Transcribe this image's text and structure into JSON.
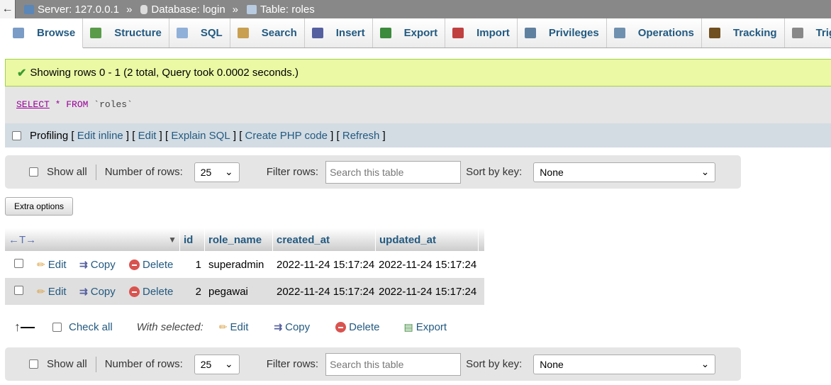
{
  "breadcrumb": {
    "back": "←",
    "server": "Server: 127.0.0.1",
    "database": "Database: login",
    "table": "Table: roles",
    "separator": "»"
  },
  "tabs": [
    {
      "label": "Browse",
      "icon": "browse-icon"
    },
    {
      "label": "Structure",
      "icon": "structure-icon"
    },
    {
      "label": "SQL",
      "icon": "sql-icon"
    },
    {
      "label": "Search",
      "icon": "search-icon"
    },
    {
      "label": "Insert",
      "icon": "insert-icon"
    },
    {
      "label": "Export",
      "icon": "export-icon"
    },
    {
      "label": "Import",
      "icon": "import-icon"
    },
    {
      "label": "Privileges",
      "icon": "privileges-icon"
    },
    {
      "label": "Operations",
      "icon": "operations-icon"
    },
    {
      "label": "Tracking",
      "icon": "tracking-icon"
    },
    {
      "label": "Trigge",
      "icon": "triggers-icon"
    }
  ],
  "success": "Showing rows 0 - 1 (2 total, Query took 0.0002 seconds.)",
  "sql": {
    "select": "SELECT",
    "star": "*",
    "from": "FROM",
    "table": "`roles`"
  },
  "profiling": {
    "label": "Profiling",
    "edit_inline": "Edit inline",
    "edit": "Edit",
    "explain": "Explain SQL",
    "php": "Create PHP code",
    "refresh": "Refresh"
  },
  "nav": {
    "show_all": "Show all",
    "rows_label": "Number of rows:",
    "rows_value": "25",
    "filter_label": "Filter rows:",
    "filter_placeholder": "Search this table",
    "sort_label": "Sort by key:",
    "sort_value": "None"
  },
  "extra_options": "Extra options",
  "table": {
    "columns": [
      "id",
      "role_name",
      "created_at",
      "updated_at"
    ],
    "rows": [
      {
        "id": "1",
        "role_name": "superadmin",
        "created_at": "2022-11-24 15:17:24",
        "updated_at": "2022-11-24 15:17:24"
      },
      {
        "id": "2",
        "role_name": "pegawai",
        "created_at": "2022-11-24 15:17:24",
        "updated_at": "2022-11-24 15:17:24"
      }
    ],
    "actions": {
      "edit": "Edit",
      "copy": "Copy",
      "delete": "Delete"
    }
  },
  "bottom": {
    "check_all": "Check all",
    "with_selected": "With selected:",
    "edit": "Edit",
    "copy": "Copy",
    "delete": "Delete",
    "export": "Export"
  }
}
